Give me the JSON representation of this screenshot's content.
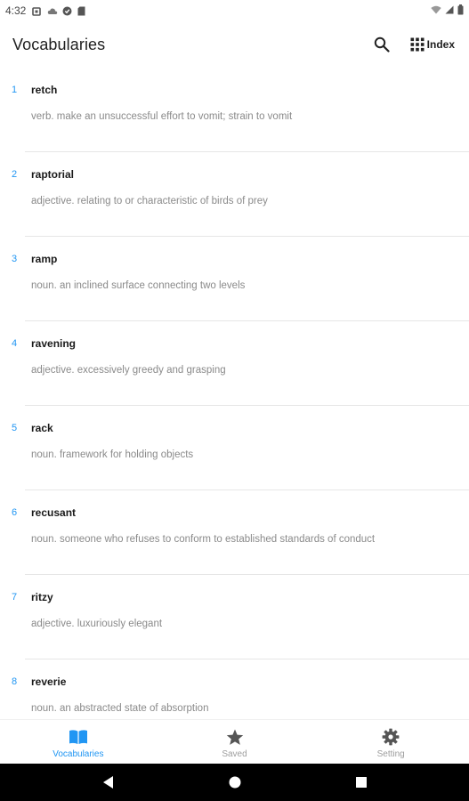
{
  "status_bar": {
    "time": "4:32",
    "left_icons": [
      "square-notification-icon",
      "cloud-icon",
      "circle-app-icon",
      "sd-card-icon"
    ],
    "right_icons": [
      "wifi-icon",
      "signal-icon",
      "battery-icon"
    ]
  },
  "app_bar": {
    "title": "Vocabularies",
    "search_icon": "search-icon",
    "index_icon": "grid-icon",
    "index_label": "Index"
  },
  "vocabularies": [
    {
      "num": "1",
      "word": "retch",
      "definition": "verb. make an unsuccessful effort to vomit; strain to vomit"
    },
    {
      "num": "2",
      "word": "raptorial",
      "definition": "adjective. relating to or characteristic of birds of prey"
    },
    {
      "num": "3",
      "word": "ramp",
      "definition": "noun. an inclined surface connecting two levels"
    },
    {
      "num": "4",
      "word": "ravening",
      "definition": "adjective. excessively greedy and grasping"
    },
    {
      "num": "5",
      "word": "rack",
      "definition": "noun. framework for holding objects"
    },
    {
      "num": "6",
      "word": "recusant",
      "definition": "noun. someone who refuses to conform to established standards of conduct"
    },
    {
      "num": "7",
      "word": "ritzy",
      "definition": "adjective. luxuriously elegant"
    },
    {
      "num": "8",
      "word": "reverie",
      "definition": "noun. an abstracted state of absorption"
    }
  ],
  "bottom_nav": {
    "items": [
      {
        "label": "Vocabularies",
        "icon": "book-icon",
        "active": true
      },
      {
        "label": "Saved",
        "icon": "star-icon",
        "active": false
      },
      {
        "label": "Setting",
        "icon": "gear-icon",
        "active": false
      }
    ]
  },
  "system_nav": {
    "buttons": [
      "back-icon",
      "home-icon",
      "recents-icon"
    ]
  },
  "colors": {
    "accent": "#2196f3",
    "inactive_nav": "#9e9e9e",
    "definition_text": "#8a8a8a",
    "divider": "#e6e6e6"
  }
}
